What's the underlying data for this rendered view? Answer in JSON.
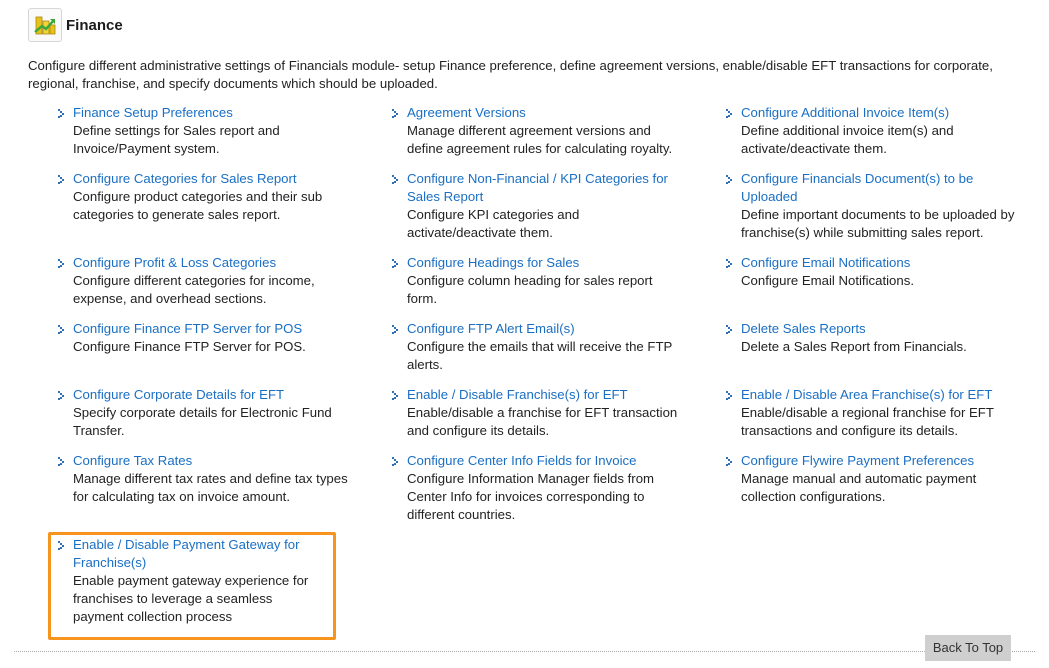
{
  "header": {
    "title": "Finance",
    "icon": "finance-module-icon"
  },
  "description": "Configure different administrative settings of Financials module- setup Finance preference, define agreement versions, enable/disable EFT transactions for corporate, regional, franchise, and specify documents which should be uploaded.",
  "items": [
    {
      "label": "Finance Setup Preferences",
      "desc": "Define settings for Sales report and Invoice/Payment system."
    },
    {
      "label": "Agreement Versions",
      "desc": "Manage different agreement versions and define agreement rules for calculating royalty."
    },
    {
      "label": "Configure Additional Invoice Item(s)",
      "desc": "Define additional invoice item(s) and activate/deactivate them."
    },
    {
      "label": "Configure Categories for Sales Report",
      "desc": "Configure product categories and their sub categories to generate sales report."
    },
    {
      "label": "Configure Non-Financial / KPI Categories for Sales Report",
      "desc": "Configure KPI categories and activate/deactivate them."
    },
    {
      "label": "Configure Financials Document(s) to be Uploaded",
      "desc": "Define important documents to be uploaded by franchise(s) while submitting sales report."
    },
    {
      "label": "Configure Profit & Loss Categories",
      "desc": "Configure different categories for income, expense, and overhead sections."
    },
    {
      "label": "Configure Headings for Sales",
      "desc": "Configure column heading for sales report form."
    },
    {
      "label": "Configure Email Notifications",
      "desc": "Configure Email Notifications."
    },
    {
      "label": "Configure Finance FTP Server for POS",
      "desc": "Configure Finance FTP Server for POS."
    },
    {
      "label": "Configure FTP Alert Email(s)",
      "desc": "Configure the emails that will receive the FTP alerts."
    },
    {
      "label": "Delete Sales Reports",
      "desc": "Delete a Sales Report from Financials."
    },
    {
      "label": "Configure Corporate Details for EFT",
      "desc": "Specify corporate details for Electronic Fund Transfer."
    },
    {
      "label": "Enable / Disable Franchise(s) for EFT",
      "desc": "Enable/disable a franchise for EFT transaction and configure its details."
    },
    {
      "label": "Enable / Disable Area Franchise(s) for EFT",
      "desc": "Enable/disable a regional franchise for EFT transactions and configure its details."
    },
    {
      "label": "Configure Tax Rates",
      "desc": "Manage different tax rates and define tax types for calculating tax on invoice amount."
    },
    {
      "label": "Configure Center Info Fields for Invoice",
      "desc": "Configure Information Manager fields from Center Info for invoices corresponding to different countries."
    },
    {
      "label": "Configure Flywire Payment Preferences",
      "desc": "Manage manual and automatic payment collection configurations."
    },
    {
      "label": "Enable / Disable Payment Gateway for Franchise(s)",
      "desc": "Enable payment gateway experience for franchises to leverage a seamless payment collection process"
    }
  ],
  "back_to_top": "Back To Top",
  "colors": {
    "link": "#1a6fc4",
    "highlight": "#f7941d",
    "bullet": "#2f6fb5"
  }
}
